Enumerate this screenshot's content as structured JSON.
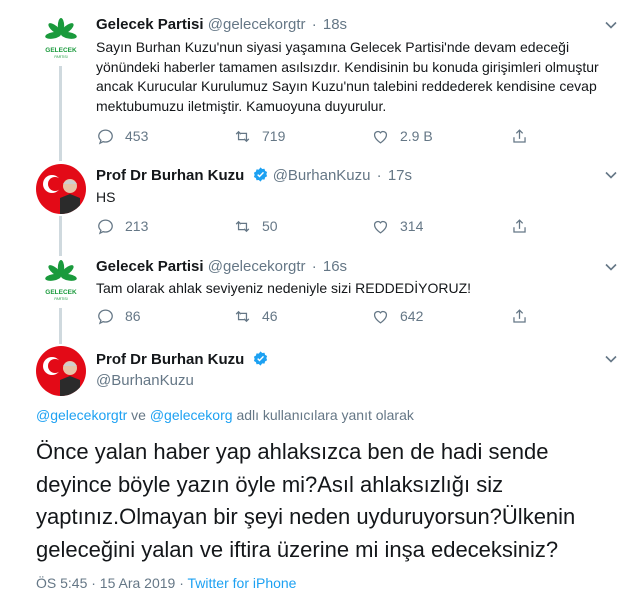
{
  "tweets": [
    {
      "name": "Gelecek Partisi",
      "handle": "@gelecekorgtr",
      "time": "18s",
      "text": "Sayın Burhan Kuzu'nun siyasi yaşamına Gelecek Partisi'nde devam edeceği yönündeki haberler tamamen asılsızdır. Kendisinin bu konuda girişimleri olmuştur ancak Kurucular Kurulumuz Sayın Kuzu'nun talebini reddederek kendisine cevap mektubumuzu iletmiştir. Kamuoyuna duyurulur.",
      "replies": "453",
      "retweets": "719",
      "likes": "2.9 B",
      "logo_text": "GELECEK",
      "logo_subtext": "PARTISI"
    },
    {
      "name": "Prof Dr Burhan Kuzu",
      "handle": "@BurhanKuzu",
      "time": "17s",
      "text": "HS",
      "replies": "213",
      "retweets": "50",
      "likes": "314"
    },
    {
      "name": "Gelecek Partisi",
      "handle": "@gelecekorgtr",
      "time": "16s",
      "text": "Tam olarak ahlak seviyeniz nedeniyle sizi REDDEDİYORUZ!",
      "replies": "86",
      "retweets": "46",
      "likes": "642",
      "logo_text": "GELECEK",
      "logo_subtext": "PARTISI"
    }
  ],
  "main": {
    "name": "Prof Dr Burhan Kuzu",
    "handle": "@BurhanKuzu",
    "replying_to_1": "@gelecekorgtr",
    "replying_and": "ve",
    "replying_to_2": "@gelecekorg",
    "replying_suffix": "adlı kullanıcılara yanıt olarak",
    "text": "Önce yalan haber yap ahlaksızca ben de hadi sende deyince böyle yazın öyle mi?Asıl ahlaksızlığı siz yaptınız.Olmayan bir şeyi neden uyduruyorsun?Ülkenin geleceğini yalan ve iftira üzerine mi inşa edeceksiniz?",
    "timestamp": "ÖS 5:45 · 15 Ara 2019",
    "separator": "·",
    "source": "Twitter for iPhone"
  },
  "colors": {
    "party_green": "#1a9a3c",
    "verified_blue": "#1da1f2",
    "muted": "#657786"
  }
}
